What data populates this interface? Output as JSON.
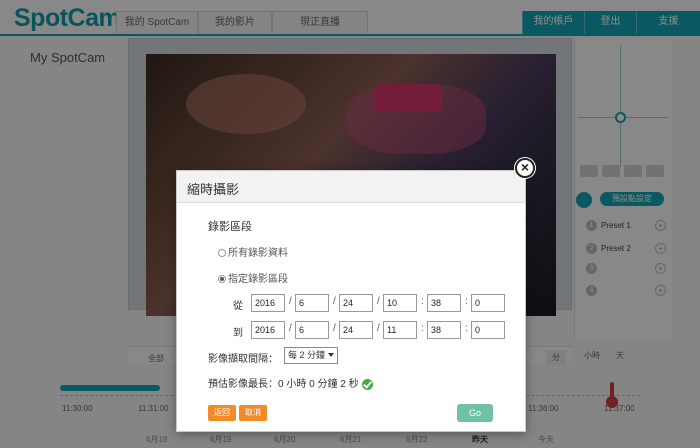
{
  "header": {
    "logo": "SpotCam",
    "nav": [
      "我的 SpotCam",
      "我的影片",
      "現正直播"
    ],
    "account": [
      "我的帳戶",
      "登出",
      "支援"
    ]
  },
  "page": {
    "title": "My SpotCam",
    "tools": [
      "scissors-icon",
      "film-icon",
      "mic-icon",
      "share-icon",
      "camera-icon"
    ]
  },
  "ptz": {
    "presets_header": "預設點設定",
    "presets": [
      {
        "num": "1",
        "label": "Preset 1"
      },
      {
        "num": "2",
        "label": "Preset 2"
      },
      {
        "num": "3",
        "label": ""
      },
      {
        "num": "4",
        "label": ""
      }
    ]
  },
  "timeline": {
    "times": [
      "11:30:00",
      "11:31:00",
      "11:36:00",
      "11:37:00"
    ],
    "dates": [
      "6月18",
      "6月19",
      "6月20",
      "6月21",
      "6月22",
      "昨天",
      "今天"
    ],
    "scale_tabs": [
      "分",
      "小時",
      "天"
    ],
    "location_label": "全部"
  },
  "dialog": {
    "title": "縮時攝影",
    "section": "錄影區段",
    "option_all": "所有錄影資料",
    "option_range": "指定錄影區段",
    "from_label": "從",
    "to_label": "到",
    "from": {
      "year": "2016",
      "month": "6",
      "day": "24",
      "hour": "10",
      "min": "38",
      "sec": "0"
    },
    "to": {
      "year": "2016",
      "month": "6",
      "day": "24",
      "hour": "11",
      "min": "38",
      "sec": "0"
    },
    "interval_label": "影像擷取間隔：",
    "interval_value": "每 2 分鐘",
    "estimate": "預估影像最長：0 小時 0 分鐘 2 秒",
    "back_label": "返回",
    "cancel_label": "取消",
    "go_label": "Go"
  },
  "colors": {
    "accent": "#13a3b2",
    "orange": "#f08a2a",
    "go": "#6fc2a8"
  }
}
